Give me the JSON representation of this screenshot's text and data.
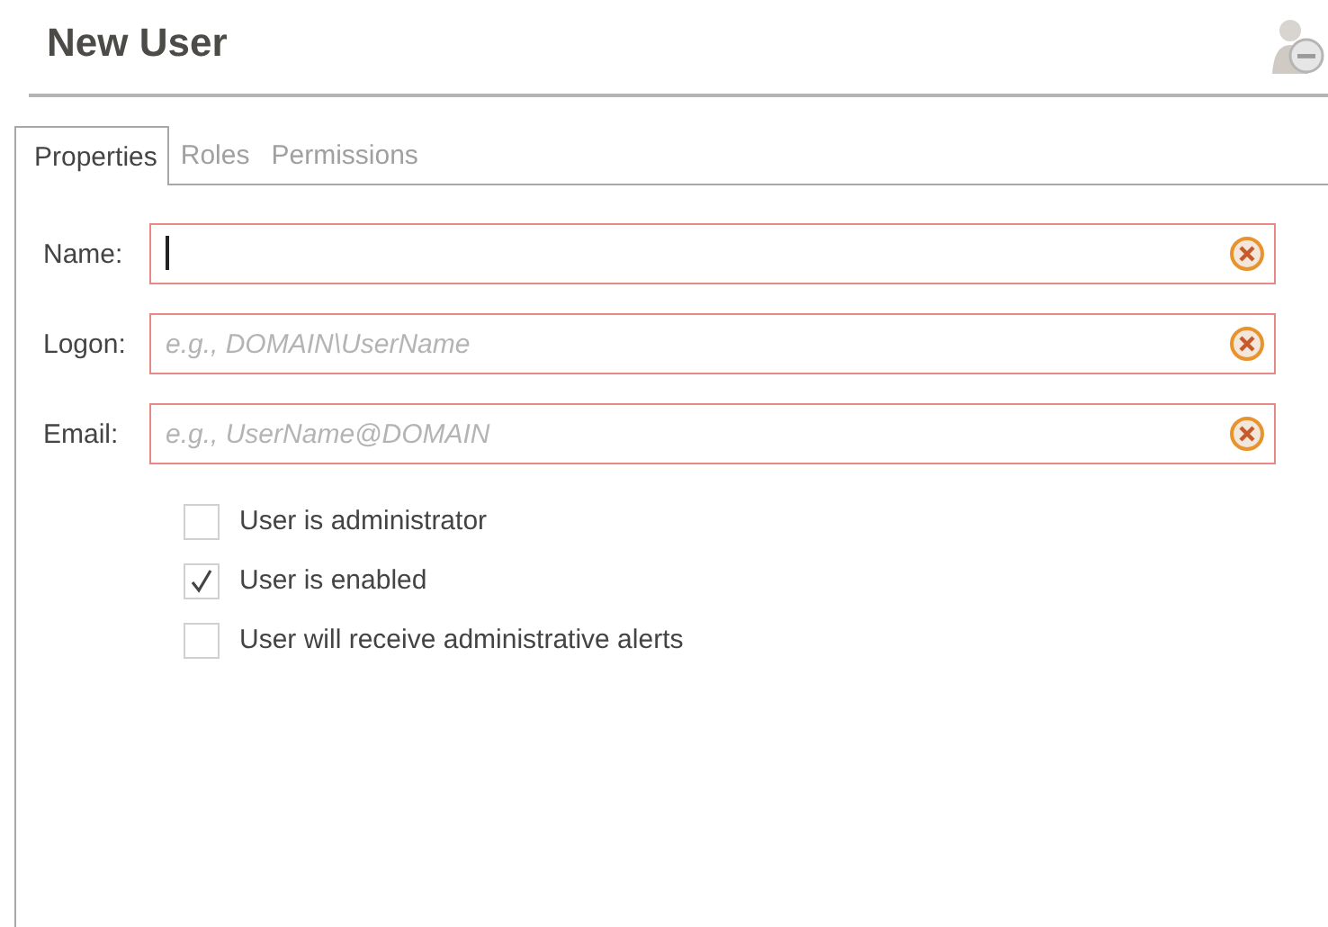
{
  "title": "New User",
  "tabs": [
    {
      "label": "Properties",
      "selected": true
    },
    {
      "label": "Roles",
      "selected": false
    },
    {
      "label": "Permissions",
      "selected": false
    }
  ],
  "fields": [
    {
      "label": "Name:",
      "focused": true,
      "error": true
    },
    {
      "label": "Logon:",
      "placeholder": "e.g., DOMAIN\\UserName",
      "focused": false,
      "error": true
    },
    {
      "label": "Email:",
      "placeholder": "e.g., UserName@DOMAIN",
      "focused": false,
      "error": true
    }
  ],
  "checkboxes": [
    {
      "label": "User is administrator",
      "checked": false
    },
    {
      "label": "User is enabled",
      "checked": true
    },
    {
      "label": "User will receive administrative alerts",
      "checked": false
    }
  ]
}
